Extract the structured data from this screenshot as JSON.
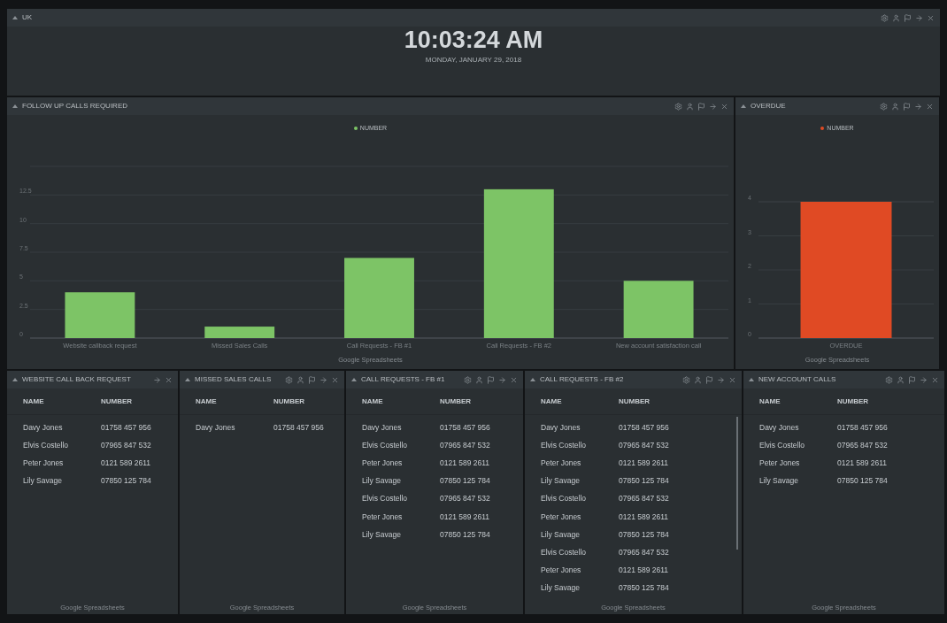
{
  "clock": {
    "title": "UK",
    "time": "10:03:24 AM",
    "date": "MONDAY, JANUARY 29, 2018"
  },
  "charts": [
    {
      "title": "FOLLOW UP CALLS REQUIRED",
      "source": "Google Spreadsheets",
      "chart_data": {
        "type": "bar",
        "categories": [
          "Website callback request",
          "Missed Sales Calls",
          "Call Requests - FB #1",
          "Call Requests - FB #2",
          "New account satisfaction call"
        ],
        "series": [
          {
            "name": "NUMBER",
            "color": "#7dc466",
            "values": [
              4,
              1,
              7,
              13,
              5
            ]
          }
        ],
        "grid": true,
        "ylim": [
          0,
          15
        ],
        "yticks": [
          0,
          2.5,
          5,
          7.5,
          10,
          12.5
        ]
      }
    },
    {
      "title": "OVERDUE",
      "source": "Google Spreadsheets",
      "chart_data": {
        "type": "bar",
        "categories": [
          "OVERDUE"
        ],
        "series": [
          {
            "name": "NUMBER",
            "color": "#e04a24",
            "values": [
              4
            ]
          }
        ],
        "grid": true,
        "ylim": [
          0,
          4
        ],
        "yticks": [
          0,
          1,
          2,
          3,
          4
        ]
      }
    }
  ],
  "tables": [
    {
      "title": "WEBSITE CALL BACK REQUEST",
      "compact_toolbar": true,
      "columns": [
        "NAME",
        "NUMBER"
      ],
      "rows": [
        [
          "Davy Jones",
          "01758 457 956"
        ],
        [
          "Elvis Costello",
          "07965 847 532"
        ],
        [
          "Peter Jones",
          "0121 589 2611"
        ],
        [
          "Lily Savage",
          "07850 125 784"
        ]
      ],
      "source": "Google Spreadsheets"
    },
    {
      "title": "MISSED SALES CALLS",
      "compact_toolbar": false,
      "columns": [
        "NAME",
        "NUMBER"
      ],
      "rows": [
        [
          "Davy Jones",
          "01758 457 956"
        ]
      ],
      "source": "Google Spreadsheets"
    },
    {
      "title": "CALL REQUESTS - FB #1",
      "compact_toolbar": false,
      "columns": [
        "NAME",
        "NUMBER"
      ],
      "rows": [
        [
          "Davy Jones",
          "01758 457 956"
        ],
        [
          "Elvis Costello",
          "07965 847 532"
        ],
        [
          "Peter Jones",
          "0121 589 2611"
        ],
        [
          "Lily Savage",
          "07850 125 784"
        ],
        [
          "Elvis Costello",
          "07965 847 532"
        ],
        [
          "Peter Jones",
          "0121 589 2611"
        ],
        [
          "Lily Savage",
          "07850 125 784"
        ]
      ],
      "source": "Google Spreadsheets"
    },
    {
      "title": "CALL REQUESTS - FB #2",
      "compact_toolbar": false,
      "columns": [
        "NAME",
        "NUMBER"
      ],
      "rows": [
        [
          "Davy Jones",
          "01758 457 956"
        ],
        [
          "Elvis Costello",
          "07965 847 532"
        ],
        [
          "Peter Jones",
          "0121 589 2611"
        ],
        [
          "Lily Savage",
          "07850 125 784"
        ],
        [
          "Elvis Costello",
          "07965 847 532"
        ],
        [
          "Peter Jones",
          "0121 589 2611"
        ],
        [
          "Lily Savage",
          "07850 125 784"
        ],
        [
          "Elvis Costello",
          "07965 847 532"
        ],
        [
          "Peter Jones",
          "0121 589 2611"
        ],
        [
          "Lily Savage",
          "07850 125 784"
        ]
      ],
      "source": "Google Spreadsheets"
    },
    {
      "title": "NEW ACCOUNT CALLS",
      "compact_toolbar": false,
      "columns": [
        "NAME",
        "NUMBER"
      ],
      "rows": [
        [
          "Davy Jones",
          "01758 457 956"
        ],
        [
          "Elvis Costello",
          "07965 847 532"
        ],
        [
          "Peter Jones",
          "0121 589 2611"
        ],
        [
          "Lily Savage",
          "07850 125 784"
        ]
      ],
      "source": "Google Spreadsheets"
    }
  ]
}
